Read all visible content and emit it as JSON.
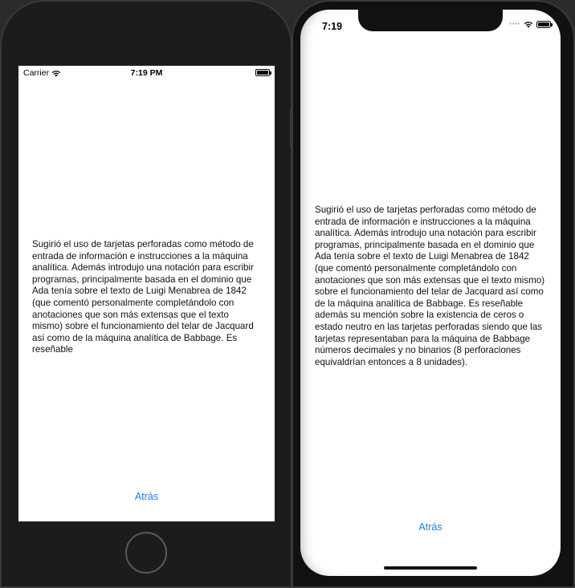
{
  "left_device": {
    "status": {
      "carrier": "Carrier",
      "time": "7:19 PM",
      "wifi_icon": "wifi-icon",
      "battery_icon": "battery-icon"
    },
    "body_text": "Sugirió el uso de tarjetas perforadas como método de entrada de información e instrucciones a la máquina analítica. Además introdujo una notación para escribir programas, principalmente basada en el dominio que Ada tenía sobre el texto de Luigi Menabrea de 1842 (que comentó personalmente completándolo con anotaciones que son más extensas que el texto mismo) sobre el funcionamiento del telar de Jacquard así como de la máquina analítica de Babbage. Es reseñable",
    "back_button": "Atrás"
  },
  "right_device": {
    "status": {
      "time": "7:19",
      "signal_icon": "signal-dots-icon",
      "wifi_icon": "wifi-icon",
      "battery_icon": "battery-icon"
    },
    "body_text": "Sugirió el uso de tarjetas perforadas como método de entrada de información e instrucciones a la máquina analítica. Además introdujo una notación para escribir programas, principalmente basada en el dominio que Ada tenía sobre el texto de Luigi Menabrea de 1842 (que comentó personalmente completándolo con anotaciones que son más extensas que el texto mismo) sobre el funcionamiento del telar de Jacquard así como de la máquina analítica de Babbage. Es reseñable además su mención sobre la existencia de ceros o estado neutro en las tarjetas perforadas siendo que las tarjetas representaban para la máquina de Babbage números decimales y no binarios (8 perforaciones equivaldrían entonces a 8 unidades).",
    "back_button": "Atrás"
  },
  "colors": {
    "link": "#1a7ef5",
    "device_body": "#1c1c1e",
    "background": "#2b2b2d"
  }
}
